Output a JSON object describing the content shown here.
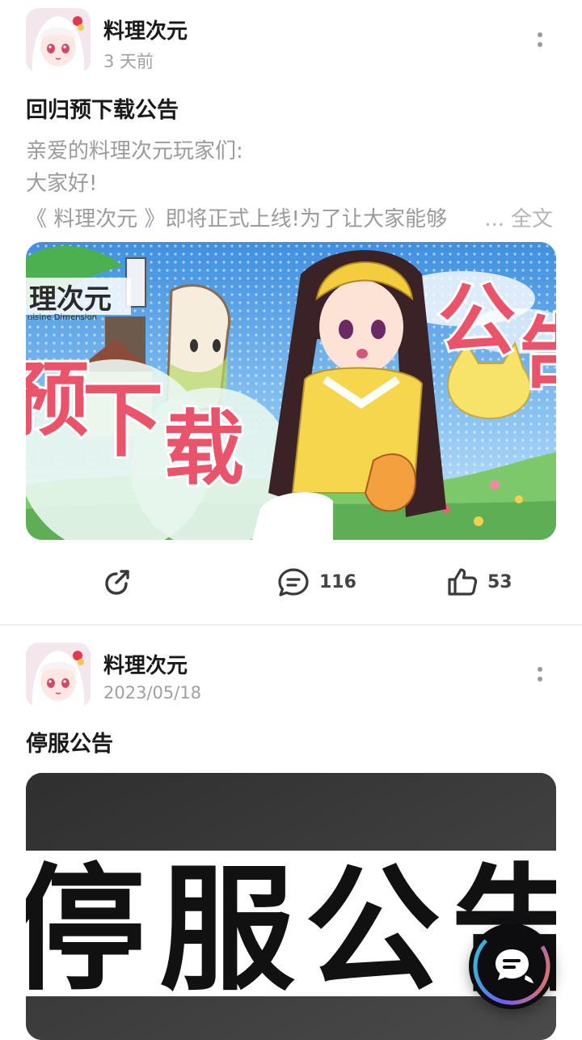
{
  "posts": [
    {
      "author": "料理次元",
      "time": "3 天前",
      "title": "回归预下载公告",
      "lines": [
        "亲爱的料理次元玩家们:",
        "大家好!",
        "《 料理次元 》即将正式上线!为了让大家能够"
      ],
      "ellipsis": "...",
      "fulltext_label": "全文",
      "banner": {
        "logo_text": "理次元",
        "logo_sub": "uisine Dimension",
        "chars_left": [
          "预",
          "下",
          "载"
        ],
        "chars_right": [
          "公",
          "告"
        ]
      },
      "actions": {
        "comments": "116",
        "likes": "53"
      }
    },
    {
      "author": "料理次元",
      "time": "2023/05/18",
      "title": "停服公告",
      "banner": {
        "chars": [
          "停",
          "服",
          "公",
          "告"
        ]
      }
    }
  ],
  "colors": {
    "accent_pink": "#e9546b",
    "banner_sky": "#4f9ee5",
    "dark_banner": "#3d3d3d"
  },
  "icons": [
    "more-vert-icon",
    "share-icon",
    "comment-icon",
    "like-icon",
    "chat-bubble-icon"
  ]
}
